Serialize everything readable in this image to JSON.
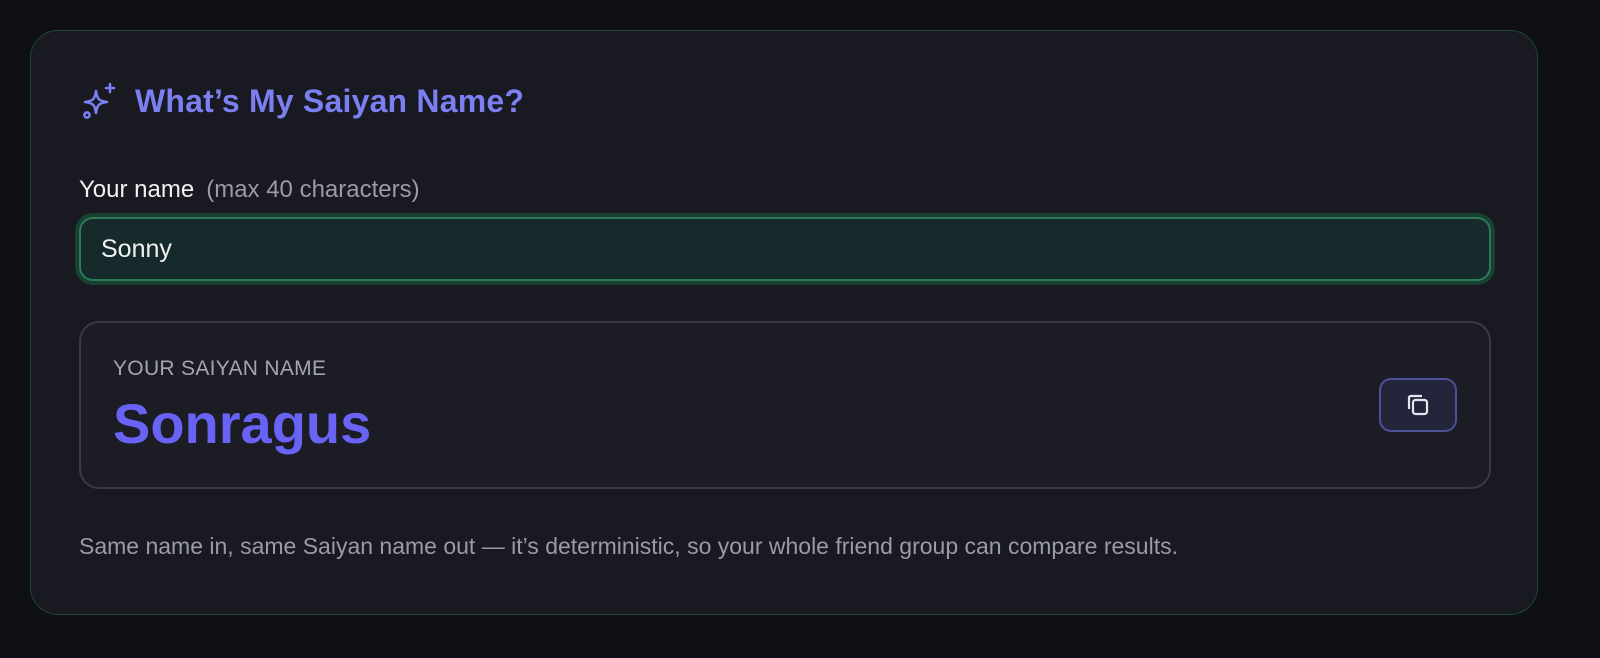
{
  "header": {
    "icon": "sparkles-icon",
    "title": "What’s My Saiyan Name?"
  },
  "form": {
    "label": "Your name",
    "hint": "(max 40 characters)",
    "input_value": "Sonny"
  },
  "result": {
    "label": "YOUR SAIYAN NAME",
    "name": "Sonragus",
    "copy_icon": "copy-icon"
  },
  "footnote": "Same name in, same Saiyan name out — it’s deterministic, so your whole friend group can compare results.",
  "colors": {
    "accent": "#7b7ff2",
    "result_name": "#6863f5",
    "card_border": "#1c4a36",
    "input_border": "#2c7a58",
    "background": "#0f1015",
    "card_background": "#181921"
  }
}
